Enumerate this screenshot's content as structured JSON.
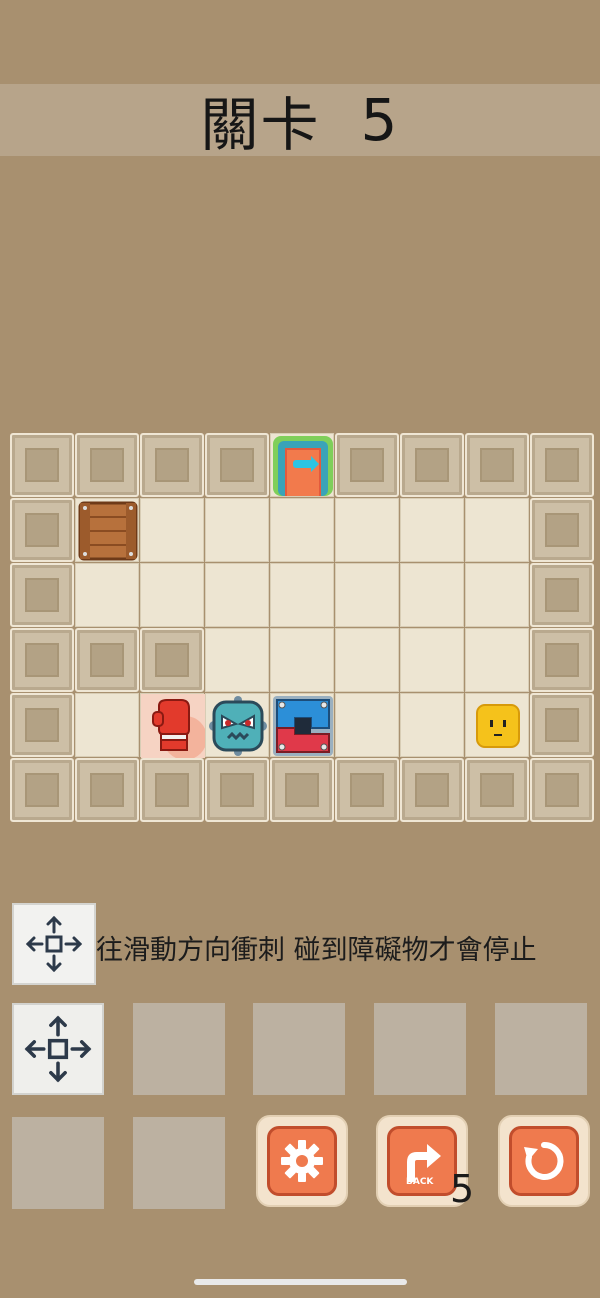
{
  "header": {
    "level_label": "關卡",
    "level_number": "5"
  },
  "board": {
    "rows": [
      [
        "wall",
        "wall",
        "wall",
        "wall",
        "exit-door",
        "wall",
        "wall",
        "wall",
        "wall"
      ],
      [
        "wall",
        "wooden-crate",
        "floor",
        "floor",
        "floor",
        "floor",
        "floor",
        "floor",
        "wall"
      ],
      [
        "wall",
        "floor",
        "floor",
        "floor",
        "floor",
        "floor",
        "floor",
        "floor",
        "wall"
      ],
      [
        "wall",
        "wall",
        "wall",
        "floor",
        "floor",
        "floor",
        "floor",
        "floor",
        "wall"
      ],
      [
        "wall",
        "floor",
        "boxing-glove",
        "spiky-monster",
        "magnet-block",
        "floor",
        "floor",
        "yellow-block-hero",
        "wall"
      ],
      [
        "wall",
        "wall",
        "wall",
        "wall",
        "wall",
        "wall",
        "wall",
        "wall",
        "wall"
      ]
    ]
  },
  "hint": {
    "icon": "move-arrows-icon",
    "text": "往滑動方向衝刺 碰到障礙物才會停止"
  },
  "controls": {
    "settings_icon": "gear-icon",
    "back_icon": "back-arrow-icon",
    "back_label": "BACK",
    "back_count": "5",
    "restart_icon": "restart-icon"
  },
  "colors": {
    "background": "#a8906f",
    "title_bar": "#b7a48a",
    "button_orange": "#ef7a4e"
  }
}
